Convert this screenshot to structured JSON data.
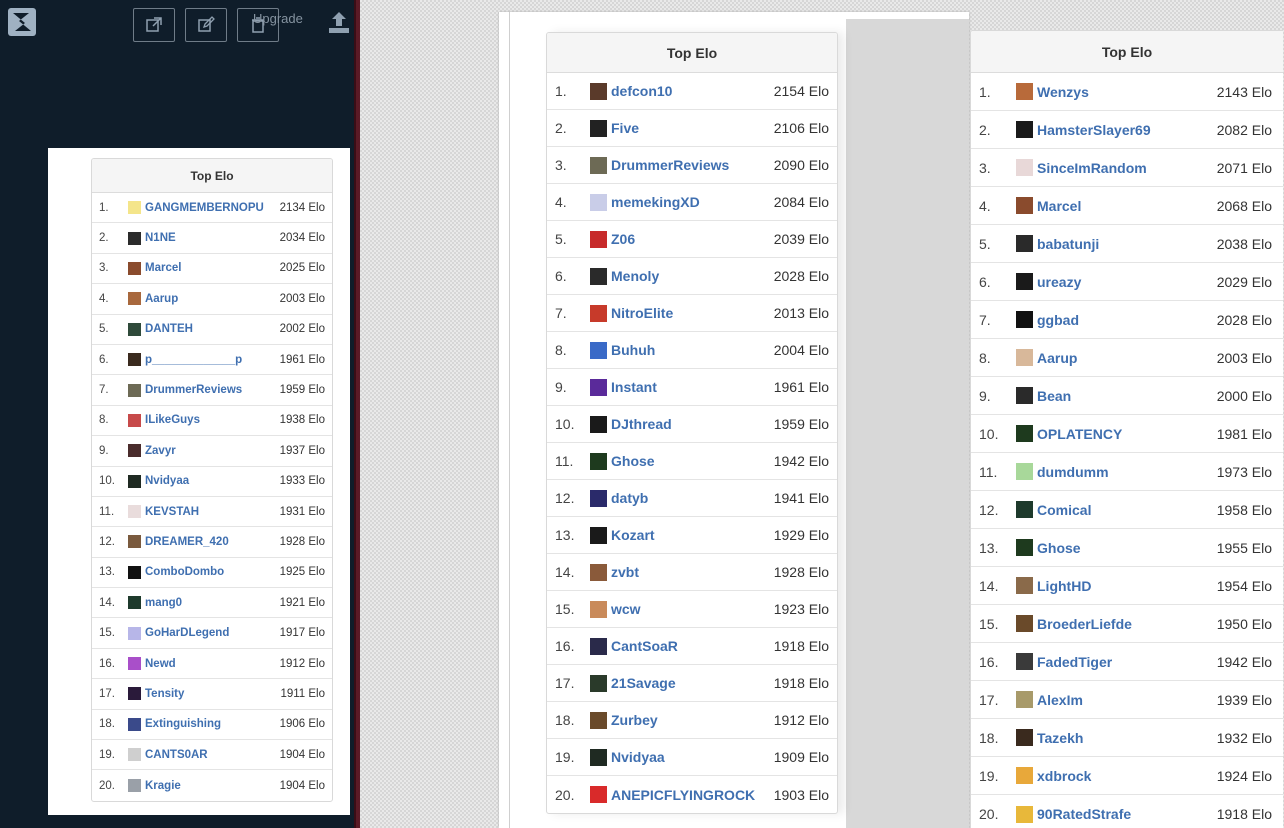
{
  "toolbar": {
    "upgrade_label": "Upgrade"
  },
  "boards": [
    {
      "title": "Top Elo",
      "rows": [
        {
          "rank": "1.",
          "name": "GANGMEMBERNOPU",
          "elo": "2134 Elo",
          "color": "#f4e58a"
        },
        {
          "rank": "2.",
          "name": "N1NE",
          "elo": "2034 Elo",
          "color": "#2b2b2b"
        },
        {
          "rank": "3.",
          "name": "Marcel",
          "elo": "2025 Elo",
          "color": "#8a4b2d"
        },
        {
          "rank": "4.",
          "name": "Aarup",
          "elo": "2003 Elo",
          "color": "#a8683d"
        },
        {
          "rank": "5.",
          "name": "DANTEH",
          "elo": "2002 Elo",
          "color": "#2f4a3a"
        },
        {
          "rank": "6.",
          "name": "p_____________p",
          "elo": "1961 Elo",
          "color": "#3a2a1e"
        },
        {
          "rank": "7.",
          "name": "DrummerReviews",
          "elo": "1959 Elo",
          "color": "#6d6a55"
        },
        {
          "rank": "8.",
          "name": "ILikeGuys",
          "elo": "1938 Elo",
          "color": "#c74a4a"
        },
        {
          "rank": "9.",
          "name": "Zavyr",
          "elo": "1937 Elo",
          "color": "#4a2c2c"
        },
        {
          "rank": "10.",
          "name": "Nvidyaa",
          "elo": "1933 Elo",
          "color": "#1f2a22"
        },
        {
          "rank": "11.",
          "name": "KEVSTAH",
          "elo": "1931 Elo",
          "color": "#e9dcdc"
        },
        {
          "rank": "12.",
          "name": "DREAMER_420",
          "elo": "1928 Elo",
          "color": "#7a5a3e"
        },
        {
          "rank": "13.",
          "name": "ComboDombo",
          "elo": "1925 Elo",
          "color": "#111111"
        },
        {
          "rank": "14.",
          "name": "mang0",
          "elo": "1921 Elo",
          "color": "#1e3a2c"
        },
        {
          "rank": "15.",
          "name": "GoHarDLegend",
          "elo": "1917 Elo",
          "color": "#b7b6e8"
        },
        {
          "rank": "16.",
          "name": "Newd",
          "elo": "1912 Elo",
          "color": "#a94fc9"
        },
        {
          "rank": "17.",
          "name": "Tensity",
          "elo": "1911 Elo",
          "color": "#2a1a3a"
        },
        {
          "rank": "18.",
          "name": "Extinguishing",
          "elo": "1906 Elo",
          "color": "#3a4a8a"
        },
        {
          "rank": "19.",
          "name": "CANTS0AR",
          "elo": "1904 Elo",
          "color": "#cfcfcf"
        },
        {
          "rank": "20.",
          "name": "Kragie",
          "elo": "1904 Elo",
          "color": "#9aa0a8"
        }
      ]
    },
    {
      "title": "Top Elo",
      "rows": [
        {
          "rank": "1.",
          "name": "defcon10",
          "elo": "2154 Elo",
          "color": "#5a3a2a"
        },
        {
          "rank": "2.",
          "name": "Five",
          "elo": "2106 Elo",
          "color": "#222222"
        },
        {
          "rank": "3.",
          "name": "DrummerReviews",
          "elo": "2090 Elo",
          "color": "#6d6a55"
        },
        {
          "rank": "4.",
          "name": "memekingXD",
          "elo": "2084 Elo",
          "color": "#c9cde8"
        },
        {
          "rank": "5.",
          "name": "Z06",
          "elo": "2039 Elo",
          "color": "#c72a2a"
        },
        {
          "rank": "6.",
          "name": "Menoly",
          "elo": "2028 Elo",
          "color": "#2a2a2a"
        },
        {
          "rank": "7.",
          "name": "NitroElite",
          "elo": "2013 Elo",
          "color": "#c73a2a"
        },
        {
          "rank": "8.",
          "name": "Buhuh",
          "elo": "2004 Elo",
          "color": "#3a6ac7"
        },
        {
          "rank": "9.",
          "name": "Instant",
          "elo": "1961 Elo",
          "color": "#5a2a9a"
        },
        {
          "rank": "10.",
          "name": "DJthread",
          "elo": "1959 Elo",
          "color": "#1a1a1a"
        },
        {
          "rank": "11.",
          "name": "Ghose",
          "elo": "1942 Elo",
          "color": "#1e3a1e"
        },
        {
          "rank": "12.",
          "name": "datyb",
          "elo": "1941 Elo",
          "color": "#2a2a6a"
        },
        {
          "rank": "13.",
          "name": "Kozart",
          "elo": "1929 Elo",
          "color": "#1a1a1a"
        },
        {
          "rank": "14.",
          "name": "zvbt",
          "elo": "1928 Elo",
          "color": "#8a5a3a"
        },
        {
          "rank": "15.",
          "name": "wcw",
          "elo": "1923 Elo",
          "color": "#c98a5a"
        },
        {
          "rank": "16.",
          "name": "CantSoaR",
          "elo": "1918 Elo",
          "color": "#2a2a4a"
        },
        {
          "rank": "17.",
          "name": "21Savage",
          "elo": "1918 Elo",
          "color": "#2a3a2a"
        },
        {
          "rank": "18.",
          "name": "Zurbey",
          "elo": "1912 Elo",
          "color": "#6a4a2a"
        },
        {
          "rank": "19.",
          "name": "Nvidyaa",
          "elo": "1909 Elo",
          "color": "#1f2a22"
        },
        {
          "rank": "20.",
          "name": "ANEPICFLYINGROCK",
          "elo": "1903 Elo",
          "color": "#d92a2a"
        }
      ]
    },
    {
      "title": "Top Elo",
      "rows": [
        {
          "rank": "1.",
          "name": "Wenzys",
          "elo": "2143 Elo",
          "color": "#b86a3a"
        },
        {
          "rank": "2.",
          "name": "HamsterSlayer69",
          "elo": "2082 Elo",
          "color": "#1a1a1a"
        },
        {
          "rank": "3.",
          "name": "SinceImRandom",
          "elo": "2071 Elo",
          "color": "#e8d8d8"
        },
        {
          "rank": "4.",
          "name": "Marcel",
          "elo": "2068 Elo",
          "color": "#8a4b2d"
        },
        {
          "rank": "5.",
          "name": "babatunji",
          "elo": "2038 Elo",
          "color": "#2a2a2a"
        },
        {
          "rank": "6.",
          "name": "ureazy",
          "elo": "2029 Elo",
          "color": "#1a1a1a"
        },
        {
          "rank": "7.",
          "name": "ggbad",
          "elo": "2028 Elo",
          "color": "#111111"
        },
        {
          "rank": "8.",
          "name": "Aarup",
          "elo": "2003 Elo",
          "color": "#d8b89a"
        },
        {
          "rank": "9.",
          "name": "Bean",
          "elo": "2000 Elo",
          "color": "#2a2a2a"
        },
        {
          "rank": "10.",
          "name": "OPLATENCY",
          "elo": "1981 Elo",
          "color": "#1e3a1e"
        },
        {
          "rank": "11.",
          "name": "dumdumm",
          "elo": "1973 Elo",
          "color": "#a8d89a"
        },
        {
          "rank": "12.",
          "name": "Comical",
          "elo": "1958 Elo",
          "color": "#1e3a2c"
        },
        {
          "rank": "13.",
          "name": "Ghose",
          "elo": "1955 Elo",
          "color": "#1e3a1e"
        },
        {
          "rank": "14.",
          "name": "LightHD",
          "elo": "1954 Elo",
          "color": "#8a6a4a"
        },
        {
          "rank": "15.",
          "name": "BroederLiefde",
          "elo": "1950 Elo",
          "color": "#6a4a2a"
        },
        {
          "rank": "16.",
          "name": "FadedTiger",
          "elo": "1942 Elo",
          "color": "#3a3a3a"
        },
        {
          "rank": "17.",
          "name": "AlexIm",
          "elo": "1939 Elo",
          "color": "#a89a6a"
        },
        {
          "rank": "18.",
          "name": "Tazekh",
          "elo": "1932 Elo",
          "color": "#3a2a1e"
        },
        {
          "rank": "19.",
          "name": "xdbrock",
          "elo": "1924 Elo",
          "color": "#e8a83a"
        },
        {
          "rank": "20.",
          "name": "90RatedStrafe",
          "elo": "1918 Elo",
          "color": "#e8b83a"
        }
      ]
    }
  ]
}
